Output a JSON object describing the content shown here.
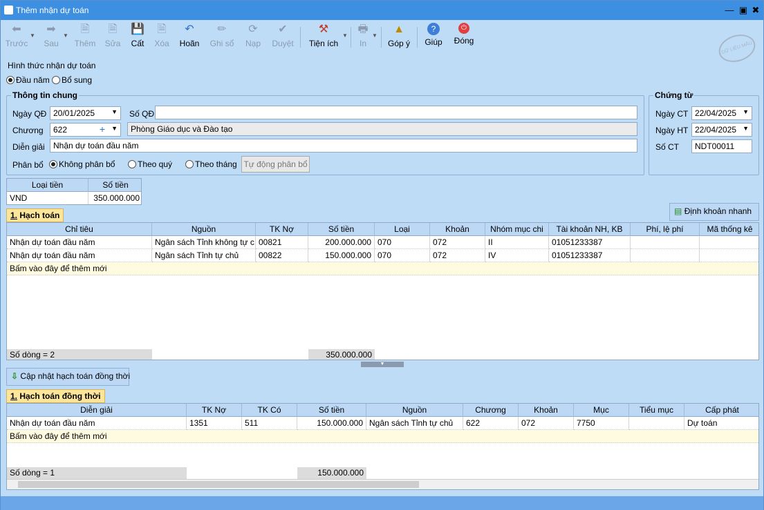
{
  "window": {
    "title": "Thêm nhận dự toán"
  },
  "toolbar": {
    "prev": "Trước",
    "next": "Sau",
    "add": "Thêm",
    "edit": "Sửa",
    "save": "Cất",
    "delete": "Xóa",
    "undo": "Hoãn",
    "post": "Ghi sổ",
    "load": "Nạp",
    "approve": "Duyệt",
    "utilities": "Tiện ích",
    "print": "In",
    "feedback": "Góp ý",
    "help": "Giúp",
    "close": "Đóng"
  },
  "form": {
    "receive_type_label": "Hình thức nhận dự toán",
    "type_options": [
      "Đầu năm",
      "Bổ sung"
    ],
    "general": {
      "title": "Thông tin chung",
      "ngay_qd_label": "Ngày QĐ",
      "ngay_qd": "20/01/2025",
      "so_qd_label": "Số QĐ",
      "so_qd": "",
      "chuong_label": "Chương",
      "chuong": "622",
      "chuong_name": "Phòng Giáo dục và Đào tạo",
      "dien_giai_label": "Diễn giải",
      "dien_giai": "Nhận dự toán đầu năm",
      "phan_bo_label": "Phân bổ",
      "phan_bo_options": [
        "Không phân bổ",
        "Theo quý",
        "Theo tháng"
      ],
      "auto_button": "Tự động phân bổ"
    },
    "voucher": {
      "title": "Chứng từ",
      "ngay_ct_label": "Ngày CT",
      "ngay_ct": "22/04/2025",
      "ngay_ht_label": "Ngày HT",
      "ngay_ht": "22/04/2025",
      "so_ct_label": "Số CT",
      "so_ct": "NDT00011"
    }
  },
  "currency": {
    "headers": [
      "Loại tiền",
      "Số tiền"
    ],
    "row": [
      "VND",
      "350.000.000"
    ]
  },
  "hach_toan": {
    "tab_num": "1.",
    "tab_label": "Hạch toán",
    "quick_button": "Định khoản nhanh",
    "headers": [
      "Chỉ tiêu",
      "Nguồn",
      "TK Nợ",
      "Số tiền",
      "Loại",
      "Khoản",
      "Nhóm mục chi",
      "Tài khoản NH, KB",
      "Phí, lệ phí",
      "Mã thống kê"
    ],
    "rows": [
      [
        "Nhận dự toán đầu năm",
        "Ngân sách Tỉnh không tự c...",
        "00821",
        "200.000.000",
        "070",
        "072",
        "II",
        "01051233387",
        "",
        ""
      ],
      [
        "Nhận dự toán đầu năm",
        "Ngân sách Tỉnh tự chủ",
        "00822",
        "150.000.000",
        "070",
        "072",
        "IV",
        "01051233387",
        "",
        ""
      ]
    ],
    "add_row_text": "Bấm vào đây để thêm mới",
    "footer_count": "Số dòng = 2",
    "footer_total": "350.000.000"
  },
  "update_button": "Cập nhật hạch toán đồng thời",
  "hach_toan_dong_thoi": {
    "tab_num": "1.",
    "tab_label": "Hạch toán đồng thời",
    "headers": [
      "Diễn giải",
      "TK Nợ",
      "TK Có",
      "Số tiền",
      "Nguồn",
      "Chương",
      "Khoản",
      "Mục",
      "Tiểu mục",
      "Cấp phát"
    ],
    "rows": [
      [
        "Nhận dự toán đầu năm",
        "1351",
        "511",
        "150.000.000",
        "Ngân sách Tỉnh tự chủ",
        "622",
        "072",
        "7750",
        "",
        "Dự toán"
      ]
    ],
    "add_row_text": "Bấm vào đây để thêm mới",
    "footer_count": "Số dòng = 1",
    "footer_total": "150.000.000"
  },
  "watermark": "DỮ LIỆU MẪU"
}
